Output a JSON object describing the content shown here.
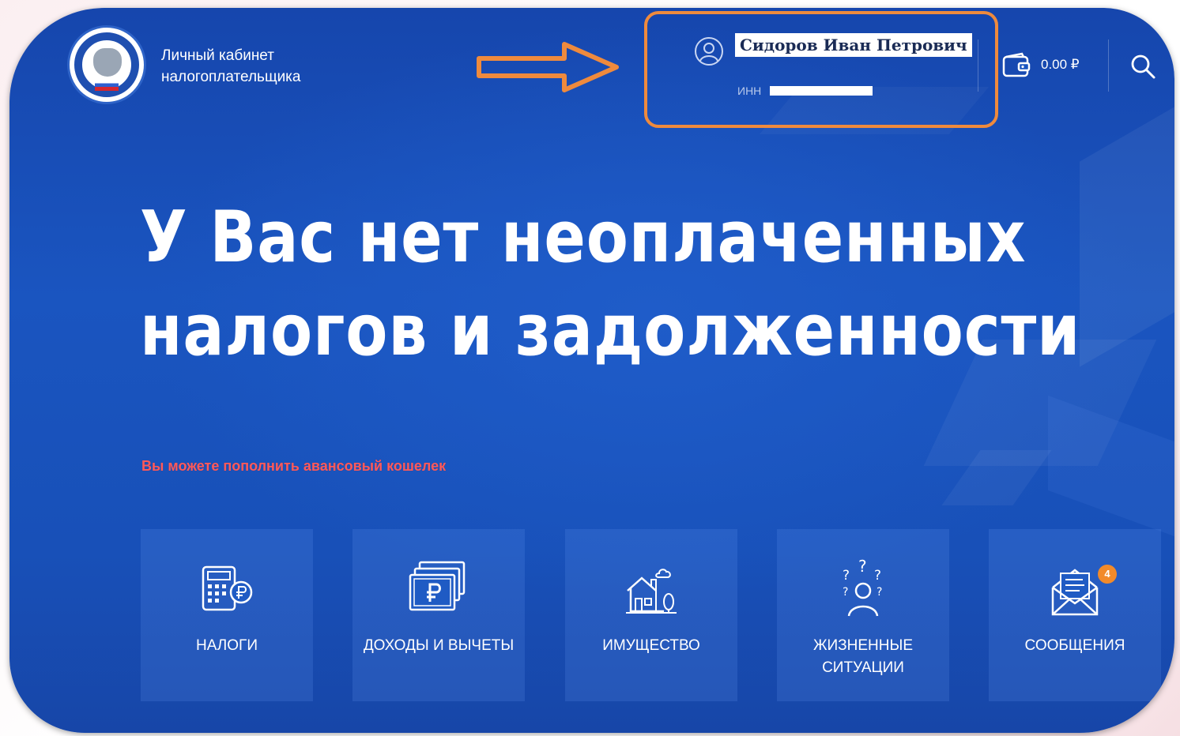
{
  "header": {
    "brand_line1": "Личный кабинет",
    "brand_line2": "налогоплательщика",
    "user_name": "Сидоров Иван Петрович",
    "inn_label": "ИНН",
    "balance": "0.00 ₽",
    "icons": {
      "logo": "fns-emblem",
      "user": "user-icon",
      "wallet": "wallet-icon",
      "search": "search-icon",
      "annotation": "arrow-right-icon"
    }
  },
  "hero": {
    "line1": "У Вас нет неоплаченных",
    "line2": "налогов и задолженности"
  },
  "hint": "Вы можете пополнить авансовый кошелек",
  "tiles": [
    {
      "label": "Налоги",
      "icon": "calculator-ruble-icon"
    },
    {
      "label": "Доходы и вычеты",
      "icon": "ruble-bills-icon"
    },
    {
      "label": "Имущество",
      "icon": "house-icon"
    },
    {
      "label": "Жизненные ситуации",
      "icon": "person-question-icon"
    },
    {
      "label": "Сообщения",
      "icon": "envelope-icon",
      "badge": "4"
    }
  ],
  "colors": {
    "background": "#1a55c0",
    "annotation": "#ef8a3d",
    "hint": "#ff5a5a",
    "badge": "#f28a2a"
  }
}
